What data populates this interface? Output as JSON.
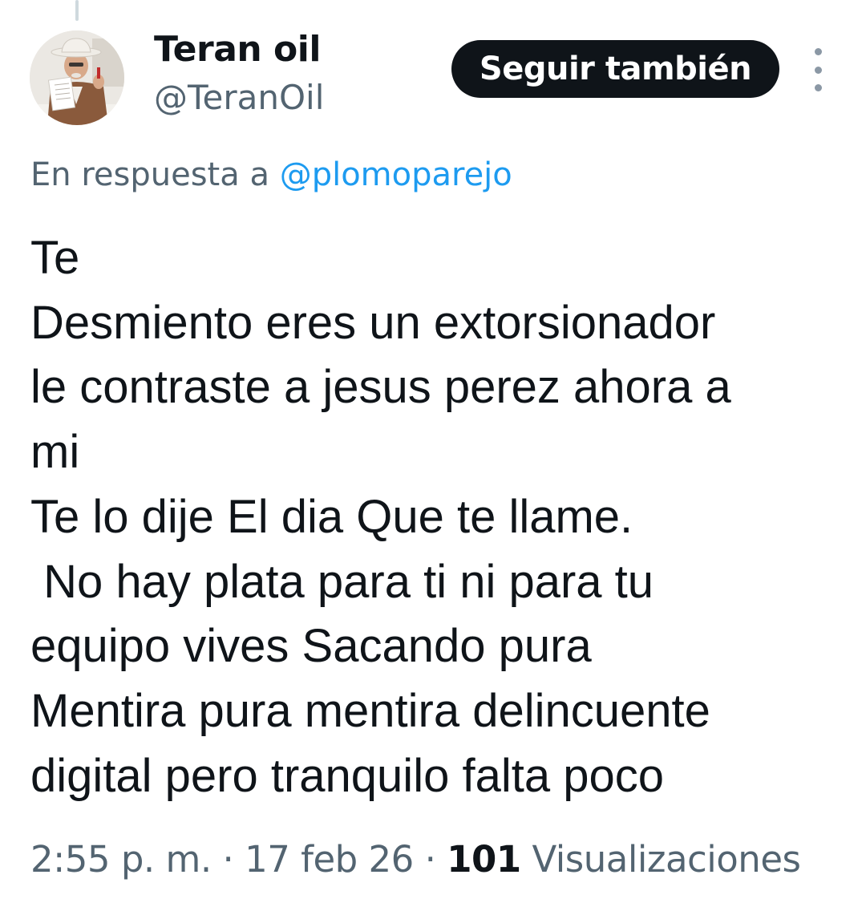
{
  "author": {
    "display_name": "Teran oil",
    "handle": "@TeranOil",
    "avatar_icon": "person-holding-document-photo"
  },
  "actions": {
    "follow_label": "Seguir también",
    "more_icon": "more-vertical-icon"
  },
  "reply": {
    "prefix": "En respuesta a ",
    "mention": "@plomoparejo"
  },
  "tweet": {
    "text": "Te\nDesmiento eres un extorsionador\nle contraste a jesus perez ahora a\nmi\nTe lo dije El dia Que te llame.\n No hay plata para ti ni para tu\nequipo vives Sacando pura\nMentira pura mentira delincuente\ndigital pero tranquilo falta poco"
  },
  "meta": {
    "time": "2:55 p. m.",
    "separator": " · ",
    "date": "17 feb 26",
    "views_count": "101",
    "views_label": " Visualizaciones"
  },
  "colors": {
    "text_primary": "#0f1419",
    "text_secondary": "#536471",
    "accent": "#1d9bf0",
    "button_bg": "#0f1419",
    "button_text": "#ffffff"
  }
}
